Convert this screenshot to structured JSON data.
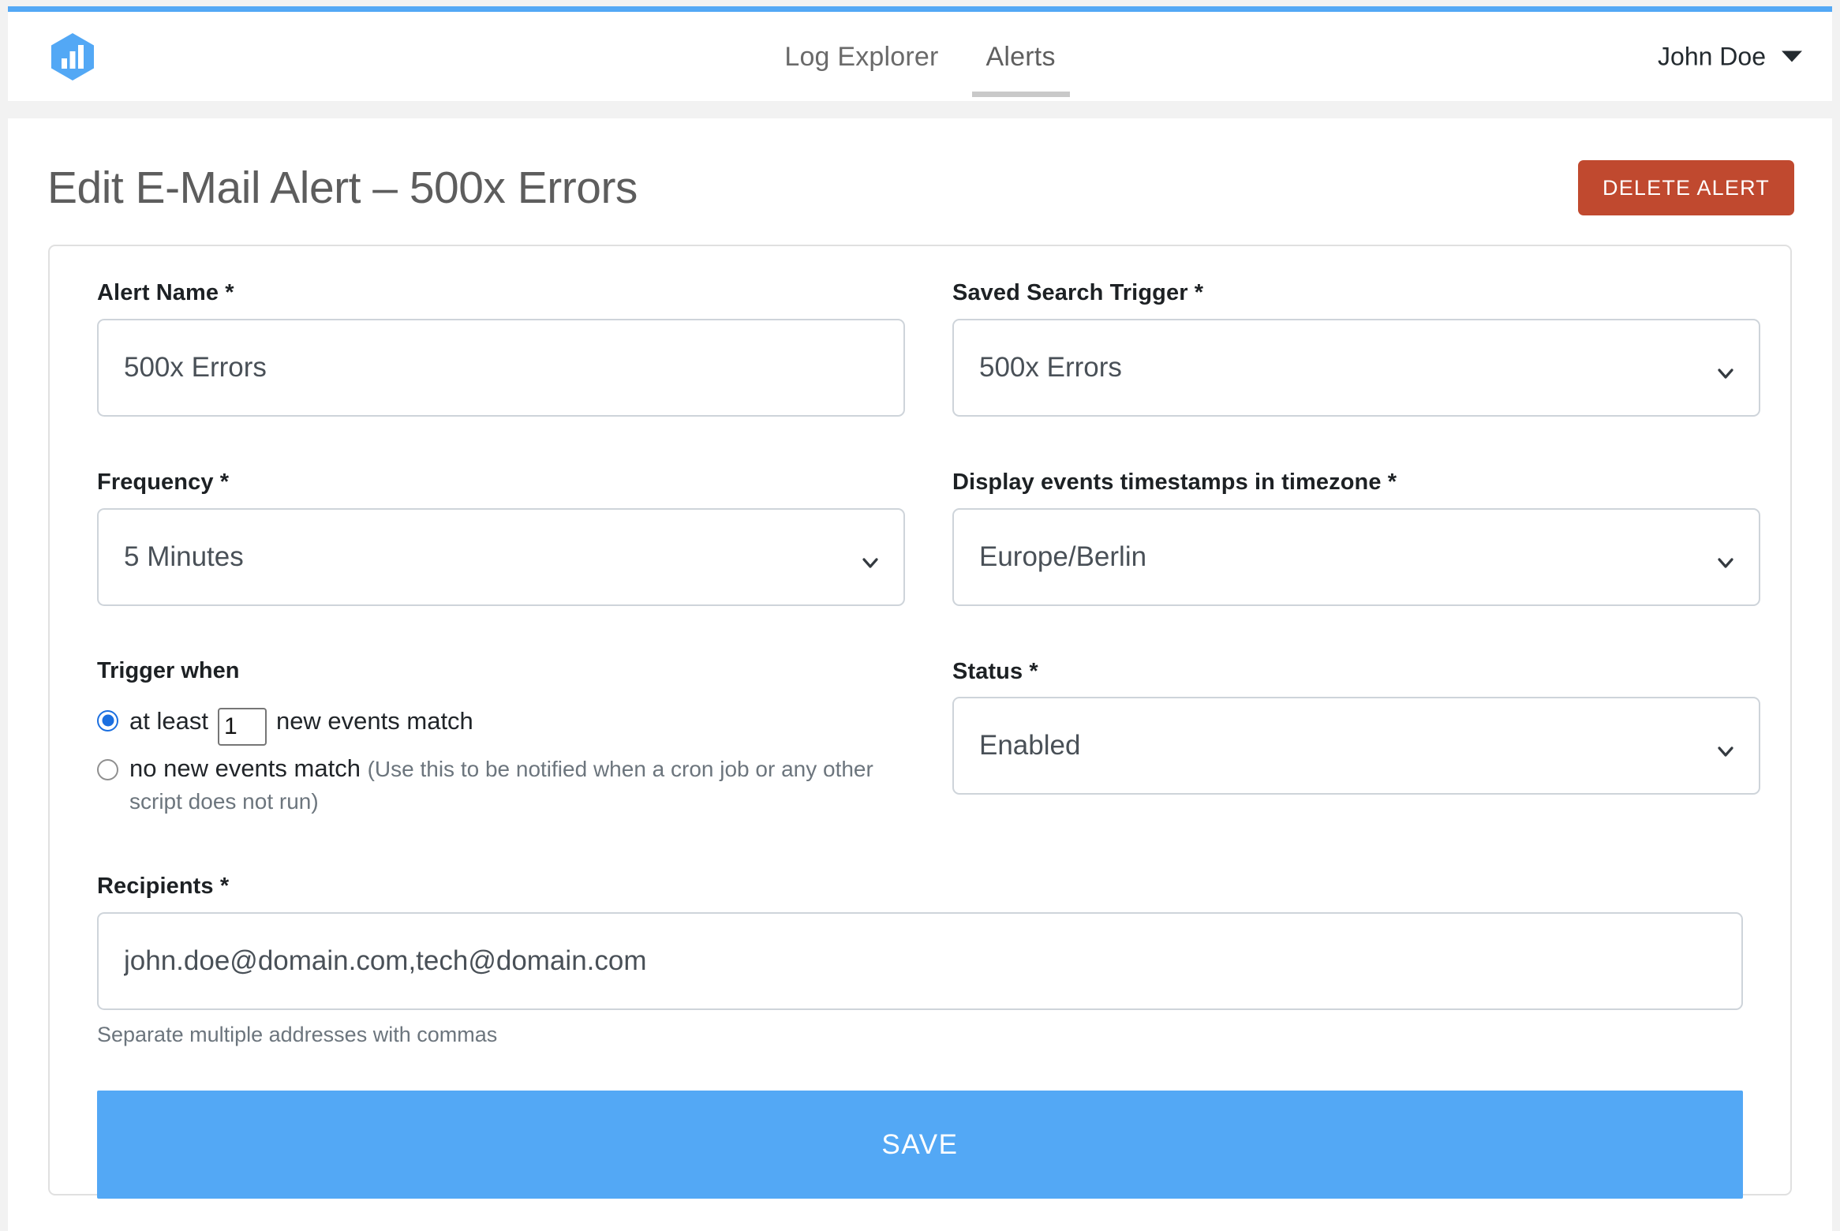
{
  "theme": {
    "accent_blue": "#53a8f5",
    "danger_red": "#c0492f",
    "radio_blue": "#1b6fe0",
    "page_bg": "#f2f2f2"
  },
  "header": {
    "logo_name": "bar-chart-hexagon-logo",
    "nav": [
      {
        "label": "Log Explorer",
        "active": false
      },
      {
        "label": "Alerts",
        "active": true
      }
    ],
    "user": {
      "name": "John Doe",
      "caret_icon": "chevron-down-icon"
    }
  },
  "main": {
    "title": "Edit E-Mail Alert – 500x Errors",
    "delete_button": "DELETE ALERT",
    "fields": {
      "alert_name": {
        "label": "Alert Name *",
        "value": "500x Errors"
      },
      "saved_search_trigger": {
        "label": "Saved Search Trigger *",
        "value": "500x Errors",
        "chevron_icon": "chevron-down-icon"
      },
      "frequency": {
        "label": "Frequency *",
        "value": "5 Minutes",
        "chevron_icon": "chevron-down-icon"
      },
      "timezone": {
        "label": "Display events timestamps in timezone *",
        "value": "Europe/Berlin",
        "chevron_icon": "chevron-down-icon"
      },
      "trigger_when": {
        "label": "Trigger when",
        "option_at_least": {
          "prefix": "at least",
          "count": "1",
          "suffix": "new events match",
          "selected": true
        },
        "option_no_new": {
          "label": "no new events match",
          "hint": "(Use this to be notified when a cron job or any other script does not run)",
          "selected": false
        }
      },
      "status": {
        "label": "Status *",
        "value": "Enabled",
        "chevron_icon": "chevron-down-icon"
      },
      "recipients": {
        "label": "Recipients *",
        "value": "john.doe@domain.com,tech@domain.com",
        "helper": "Separate multiple addresses with commas"
      }
    },
    "save_button": "SAVE"
  }
}
